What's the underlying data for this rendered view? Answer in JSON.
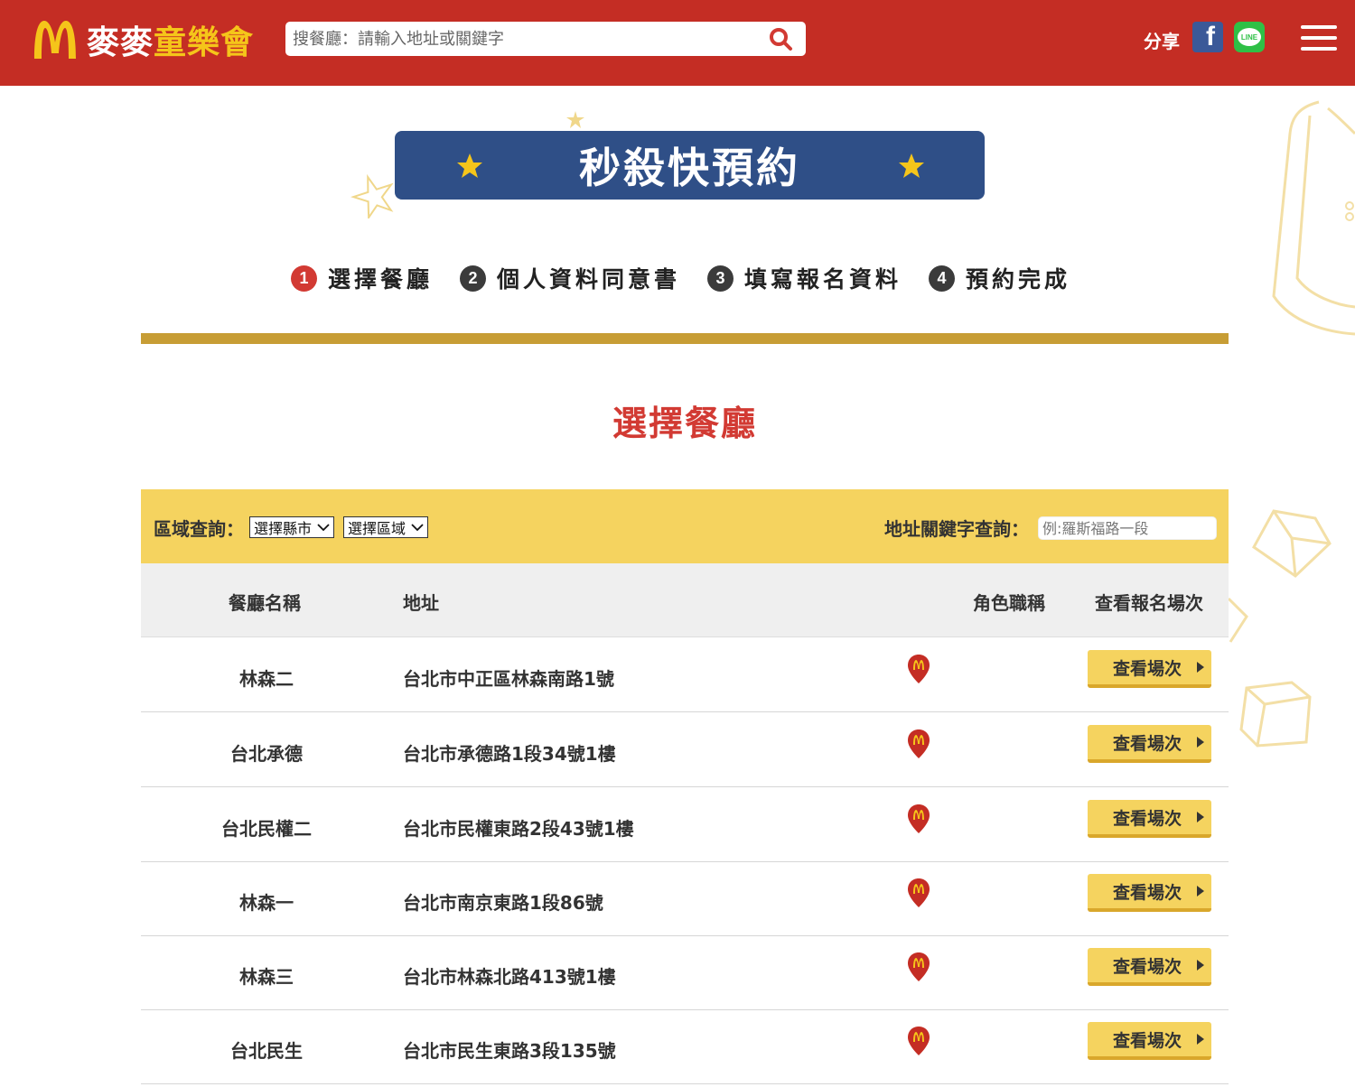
{
  "header": {
    "brand_part1": "麥麥",
    "brand_part2": "童樂會",
    "search_placeholder": "搜餐廳：請輸入地址或關鍵字",
    "share_label": "分享",
    "facebook_glyph": "f",
    "line_glyph": "LINE"
  },
  "banner": {
    "title": "秒殺快預約"
  },
  "steps": [
    {
      "num": "1",
      "label": "選擇餐廳",
      "active": true
    },
    {
      "num": "2",
      "label": "個人資料同意書",
      "active": false
    },
    {
      "num": "3",
      "label": "填寫報名資料",
      "active": false
    },
    {
      "num": "4",
      "label": "預約完成",
      "active": false
    }
  ],
  "section_title": "選擇餐廳",
  "filter": {
    "region_label": "區域查詢：",
    "city_select": "選擇縣市",
    "district_select": "選擇區域",
    "keyword_label": "地址關鍵字查詢：",
    "keyword_placeholder": "例:羅斯福路一段"
  },
  "table": {
    "headers": [
      "餐廳名稱",
      "地址",
      "角色職稱",
      "查看報名場次"
    ],
    "button_label": "查看場次",
    "rows": [
      {
        "name": "林森二",
        "address": "台北市中正區林森南路1號"
      },
      {
        "name": "台北承德",
        "address": "台北市承德路1段34號1樓"
      },
      {
        "name": "台北民權二",
        "address": "台北市民權東路2段43號1樓"
      },
      {
        "name": "林森一",
        "address": "台北市南京東路1段86號"
      },
      {
        "name": "林森三",
        "address": "台北市林森北路413號1樓"
      },
      {
        "name": "台北民生",
        "address": "台北市民生東路3段135號"
      }
    ]
  },
  "colors": {
    "header_red": "#c42d24",
    "banner_blue": "#2f4f87",
    "gold_bar": "#c79d35",
    "filter_yellow": "#f5d35f",
    "title_red": "#d23a33"
  }
}
